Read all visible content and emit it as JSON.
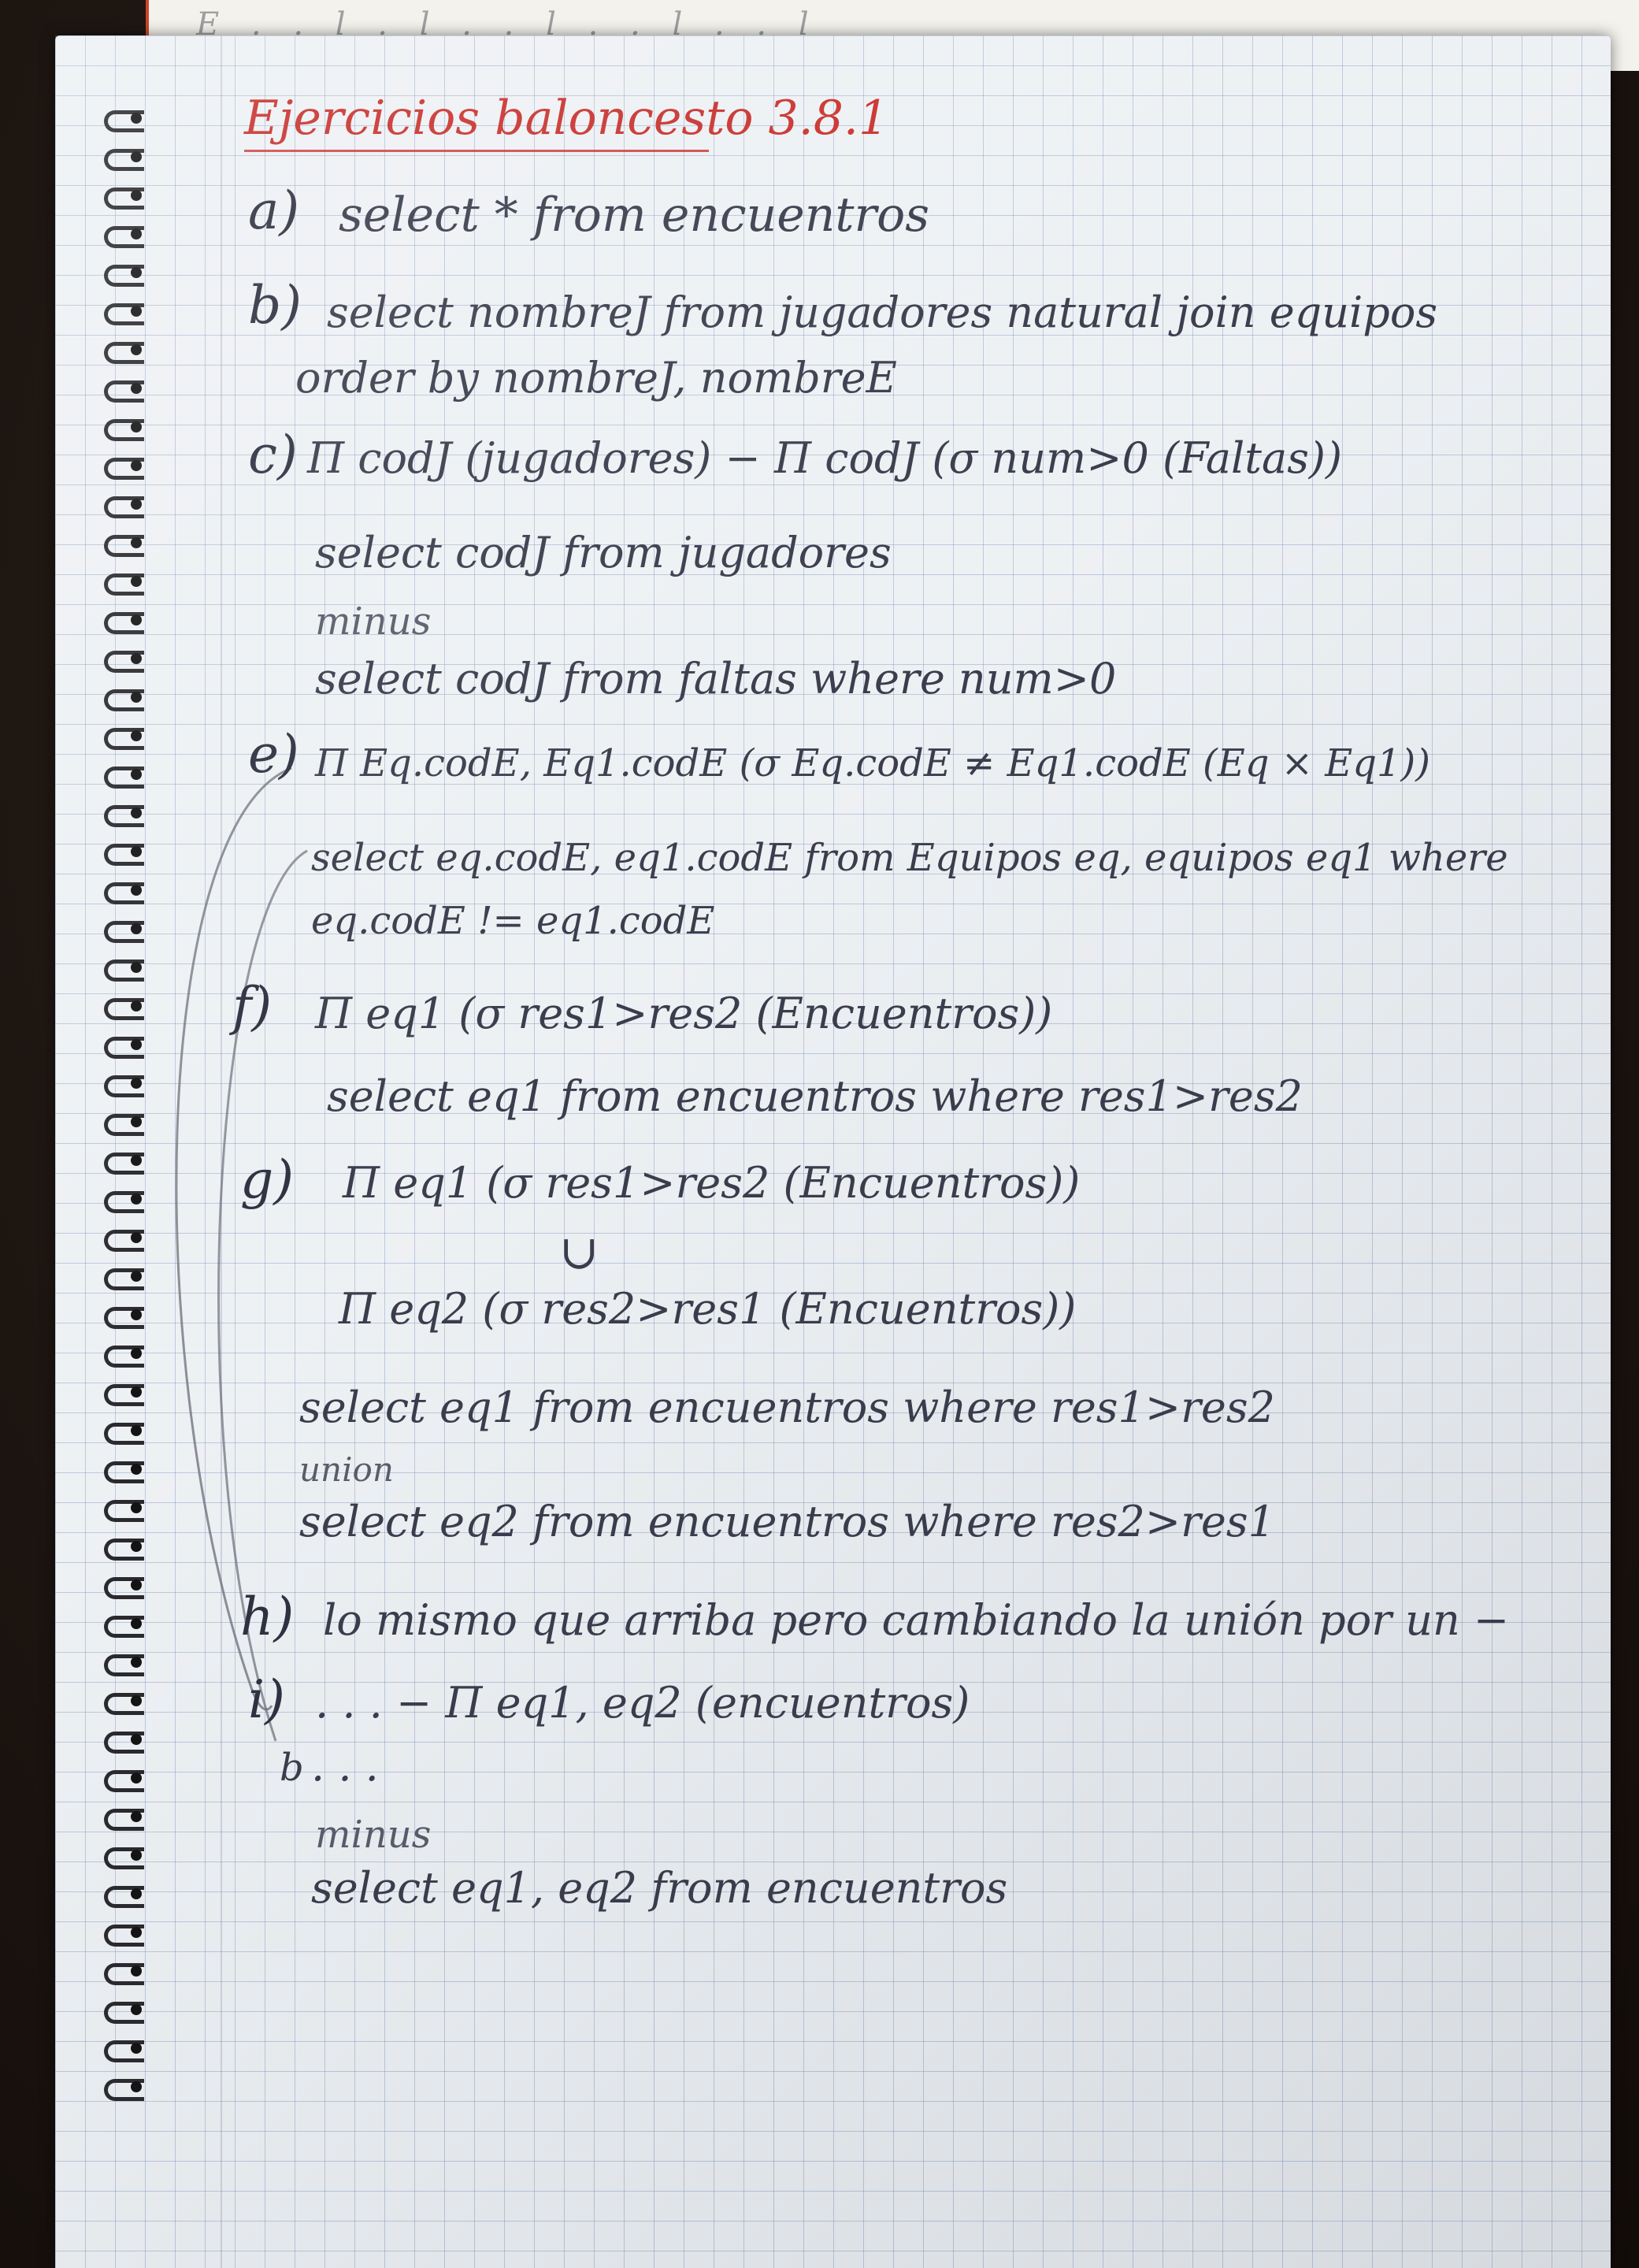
{
  "title": "Ejercicios baloncesto 3.8.1",
  "under_sheet_text": "E . . l . l . . l . . l . . l",
  "items": [
    {
      "label": "a)",
      "lines": [
        "select * from encuentros"
      ]
    },
    {
      "label": "b)",
      "lines": [
        "select nombreJ from jugadores natural join equipos",
        "order by nombreJ, nombreE"
      ]
    },
    {
      "label": "c)",
      "lines": [
        "Π codJ (jugadores) − Π codJ (σ num>0 (Faltas))",
        "select codJ from jugadores",
        "minus",
        "select codJ from faltas where num>0"
      ]
    },
    {
      "label": "e)",
      "lines": [
        "Π Eq.codE, Eq1.codE (σ Eq.codE ≠ Eq1.codE (Eq × Eq1))",
        "select eq.codE, eq1.codE from Equipos eq, equipos eq1 where",
        "eq.codE != eq1.codE"
      ]
    },
    {
      "label": "f)",
      "lines": [
        "Π eq1 (σ res1>res2 (Encuentros))",
        "select eq1 from encuentros where res1>res2"
      ]
    },
    {
      "label": "g)",
      "lines": [
        "Π eq1 (σ res1>res2 (Encuentros))",
        "∪",
        "Π eq2 (σ res2>res1 (Encuentros))",
        "select eq1 from encuentros where res1>res2",
        "union",
        "select eq2 from encuentros where res2>res1"
      ]
    },
    {
      "label": "h)",
      "lines": [
        "lo mismo que arriba pero cambiando la unión por un −"
      ]
    },
    {
      "label": "i)",
      "lines": [
        ". . .  − Π eq1, eq2 (encuentros)"
      ]
    },
    {
      "label": "b",
      "lines": [
        ". . .",
        "minus",
        "select eq1, eq2 from encuentros"
      ]
    }
  ],
  "colors": {
    "ink": "#3b3c4c",
    "title_ink": "#c8302c",
    "paper": "#eef1f4",
    "grid": "#7891b9"
  }
}
